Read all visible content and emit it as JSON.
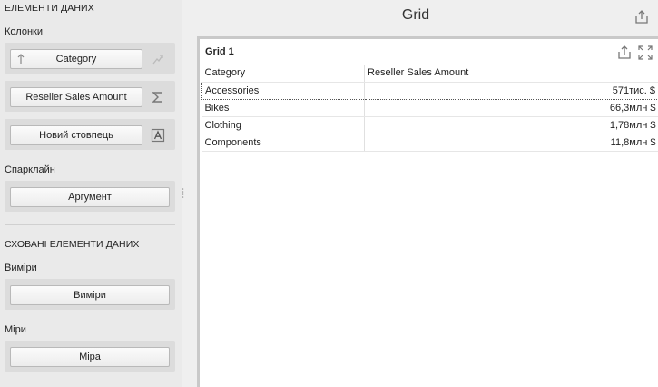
{
  "left_panel": {
    "title": "ЕЛЕМЕНТИ ДАНИХ",
    "columns_label": "Колонки",
    "columns": [
      {
        "label": "Category",
        "icon": "sort-ascending-arrow-icon",
        "side_icon": "sparkline-chart-icon"
      },
      {
        "label": "Reseller Sales Amount",
        "side_icon": "sigma-sum-icon"
      },
      {
        "label": "Новий стовпець",
        "side_icon": "text-box-a-icon"
      }
    ],
    "sparkline_label": "Спарклайн",
    "argument_label": "Аргумент",
    "hidden_title": "СХОВАНІ ЕЛЕМЕНТИ ДАНИХ",
    "dimensions_label": "Виміри",
    "dimensions_button": "Виміри",
    "measures_label": "Міри",
    "measures_button": "Міра"
  },
  "main": {
    "title": "Grid",
    "card": {
      "title": "Grid 1",
      "columns": [
        "Category",
        "Reseller Sales Amount"
      ],
      "rows": [
        {
          "category": "Accessories",
          "amount": "571тис. $"
        },
        {
          "category": "Bikes",
          "amount": "66,3млн $"
        },
        {
          "category": "Clothing",
          "amount": "1,78млн $"
        },
        {
          "category": "Components",
          "amount": "11,8млн $"
        }
      ]
    }
  },
  "colors": {
    "background": "#efefef",
    "panel": "#eaeaea",
    "row_bg": "#dcdcdc",
    "card_border": "#c9c9c9"
  }
}
